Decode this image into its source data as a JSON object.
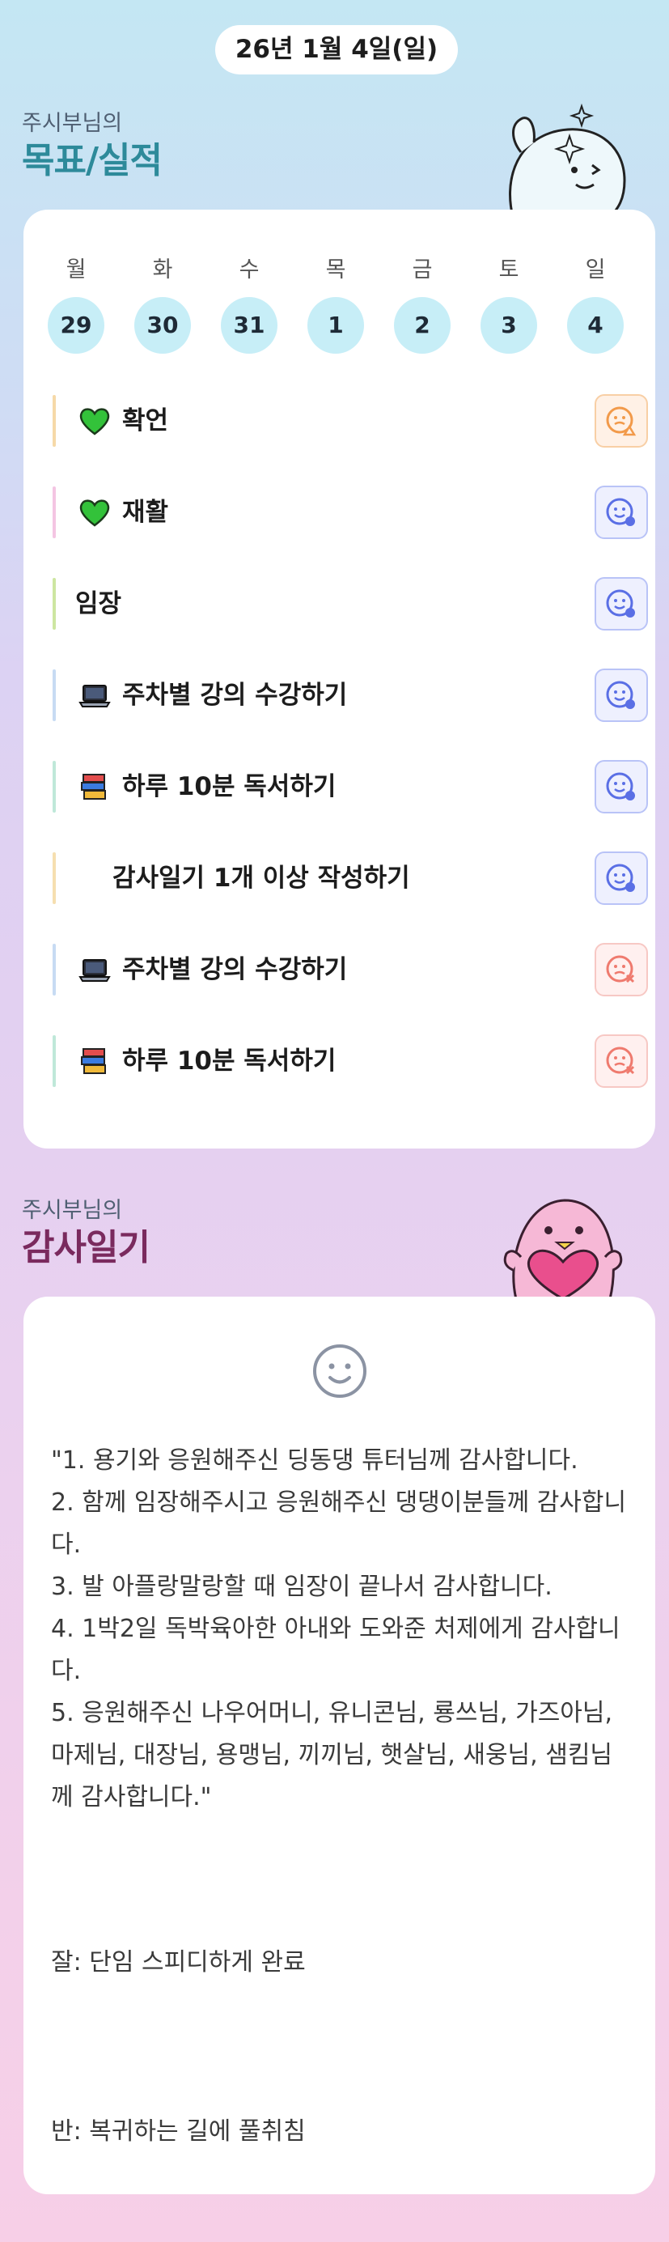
{
  "date_label": "26년 1월 4일(일)",
  "goals_section": {
    "prefix": "주시부님의",
    "title": "목표/실적"
  },
  "week": {
    "day_names": [
      "월",
      "화",
      "수",
      "목",
      "금",
      "토",
      "일"
    ],
    "day_numbers": [
      "29",
      "30",
      "31",
      "1",
      "2",
      "3",
      "4"
    ]
  },
  "goals": [
    {
      "label": "확언",
      "icon": "green-heart-icon",
      "bar_color": "#f6d9a8",
      "status": "warn",
      "status_color": "#f29a4a"
    },
    {
      "label": "재활",
      "icon": "green-heart-icon",
      "bar_color": "#f4c5e3",
      "status": "done",
      "status_color": "#5a6fe5"
    },
    {
      "label": "임장",
      "icon": "",
      "bar_color": "#cde6a1",
      "status": "done",
      "status_color": "#5a6fe5"
    },
    {
      "label": "주차별 강의 수강하기",
      "icon": "laptop-icon",
      "bar_color": "#c7dbf3",
      "status": "done",
      "status_color": "#5a6fe5"
    },
    {
      "label": "하루 10분 독서하기",
      "icon": "books-icon",
      "bar_color": "#bfe8d9",
      "status": "done",
      "status_color": "#5a6fe5"
    },
    {
      "label": "감사일기 1개 이상 작성하기",
      "icon": "",
      "bar_color": "#f6dfb0",
      "status": "done",
      "status_color": "#5a6fe5"
    },
    {
      "label": "주차별 강의 수강하기",
      "icon": "laptop-icon",
      "bar_color": "#c7dbf3",
      "status": "fail",
      "status_color": "#ef7a6e"
    },
    {
      "label": "하루 10분 독서하기",
      "icon": "books-icon",
      "bar_color": "#bfe8d9",
      "status": "fail",
      "status_color": "#ef7a6e"
    }
  ],
  "journal_section": {
    "prefix": "주시부님의",
    "title": "감사일기"
  },
  "journal": {
    "mood_icon": "smile-face-icon",
    "body": "\"1. 용기와 응원해주신 딩동댕 튜터님께 감사합니다.\n2. 함께 임장해주시고 응원해주신 댕댕이분들께 감사합니다.\n3. 발 아플랑말랑할 때 임장이 끝나서 감사합니다.\n4. 1박2일 독박육아한 아내와 도와준 처제에게 감사합니다.\n5. 응원해주신 나우어머니, 유니콘님, 룡쓰님, 가즈아님, 마제님, 대장님, 용맹님, 끼끼님, 햇살님, 새웅님, 샘킴님께 감사합니다.\"",
    "good": "잘: 단임 스피디하게 완료",
    "bad": "반: 복귀하는 길에 풀취침"
  },
  "colors": {
    "goals_title": "#2d8a9a",
    "journal_title": "#7a2a5e",
    "done": "#5a6fe5",
    "warn": "#f29a4a",
    "fail": "#ef7a6e"
  }
}
